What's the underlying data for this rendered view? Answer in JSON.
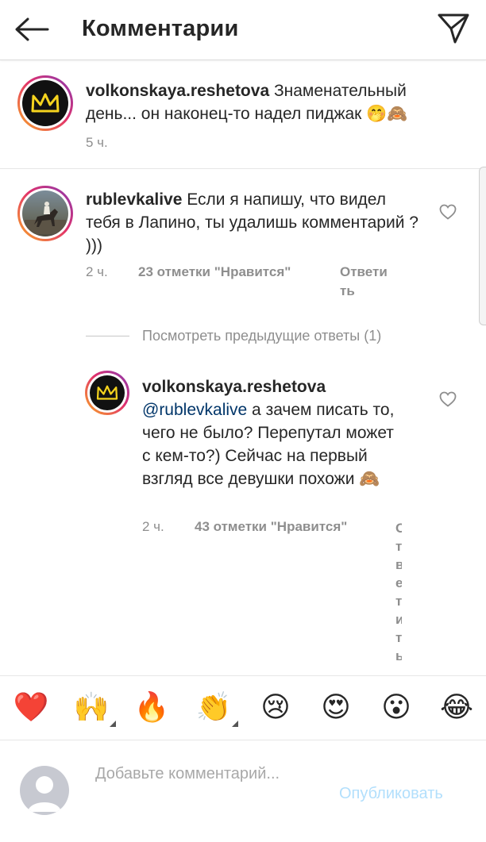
{
  "header": {
    "title": "Комментарии",
    "back_icon": "arrow-left-icon",
    "share_icon": "paper-plane-icon"
  },
  "caption": {
    "username": "volkonskaya.reshetova",
    "text": " Знаменательный день... он наконец-то надел пиджак 🤭🙈",
    "time": "5 ч."
  },
  "comment": {
    "username": "rublevkalive",
    "text": " Если я напишу, что видел тебя в Лапино, ты удалишь комментарий ? )))",
    "time": "2 ч.",
    "likes": "23 отметки \"Нравится\"",
    "reply_line1": "Ответи",
    "reply_line2": "ть"
  },
  "view_previous": "Посмотреть предыдущие ответы (1)",
  "reply": {
    "username": "volkonskaya.reshetova",
    "mention": "@rublevkalive",
    "text": " а зачем писать то, чего не было? Перепутал может с кем-то?) Сейчас на первый взгляд все девушки похожи 🙈",
    "time": "2 ч.",
    "likes": "43 отметки \"Нравится\"",
    "reply_clipped": [
      "О",
      "т",
      "в",
      "е",
      "т",
      "и",
      "т",
      "ь"
    ]
  },
  "emoji_bar": [
    {
      "emoji": "❤️",
      "name": "red-heart"
    },
    {
      "emoji": "🙌",
      "name": "raising-hands"
    },
    {
      "emoji": "🔥",
      "name": "fire"
    },
    {
      "emoji": "👏",
      "name": "clapping-hands"
    },
    {
      "emoji": "😢",
      "name": "crying-face"
    },
    {
      "emoji": "😍",
      "name": "heart-eyes"
    },
    {
      "emoji": "😮",
      "name": "surprised-face"
    },
    {
      "emoji": "😂",
      "name": "tears-of-joy"
    }
  ],
  "input": {
    "placeholder": "Добавьте комментарий...",
    "value": "",
    "publish_label": "Опубликовать"
  },
  "colors": {
    "text": "#262626",
    "secondary": "#8e8e8e",
    "mention": "#003569",
    "publish_disabled": "#b2dffc"
  }
}
